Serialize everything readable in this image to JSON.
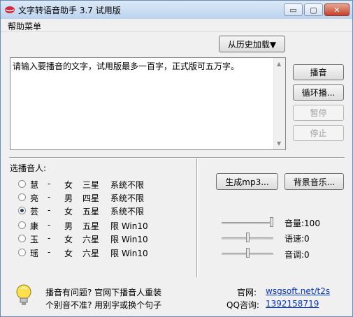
{
  "window": {
    "title": "文字转语音助手 3.7 试用版",
    "min_glyph": "▭",
    "max_glyph": "▢",
    "close_glyph": "✕"
  },
  "menu": {
    "help": "帮助菜单"
  },
  "history_button": "从历史加载▼",
  "text_input": {
    "value": "请输入要播音的文字，试用版最多一百字，正式版可五万字。"
  },
  "scroll": {
    "up": "▲",
    "down": "▼"
  },
  "side_buttons": {
    "play": "播音",
    "loop": "循环播...",
    "pause": "暂停",
    "stop": "停止"
  },
  "voice_section": {
    "label": "选播音人:",
    "voices": [
      {
        "name": "慧",
        "gender": "女",
        "stars": "三星",
        "limit": "系统不限",
        "checked": false
      },
      {
        "name": "亮",
        "gender": "男",
        "stars": "四星",
        "limit": "系统不限",
        "checked": false
      },
      {
        "name": "芸",
        "gender": "女",
        "stars": "五星",
        "limit": "系统不限",
        "checked": true
      },
      {
        "name": "康",
        "gender": "男",
        "stars": "五星",
        "limit": "限 Win10",
        "checked": false
      },
      {
        "name": "玉",
        "gender": "女",
        "stars": "六星",
        "limit": "限 Win10",
        "checked": false
      },
      {
        "name": "瑶",
        "gender": "女",
        "stars": "六星",
        "limit": "限 Win10",
        "checked": false
      }
    ]
  },
  "actions": {
    "mp3": "生成mp3...",
    "bgm": "背景音乐..."
  },
  "sliders": {
    "volume": {
      "label": "音量:100",
      "fraction": 1.0
    },
    "speed": {
      "label": "语速:0",
      "fraction": 0.5
    },
    "pitch": {
      "label": "音调:0",
      "fraction": 0.5
    }
  },
  "footer": {
    "tip_line1": "播音有问题? 官网下播音人重装",
    "tip_line2": "个别音不准? 用别字或换个句子",
    "site_label": "官网:",
    "site_link": "wsgsoft.net/t2s",
    "qq_label": "QQ咨询:",
    "qq_value": "1392158719"
  },
  "colors": {
    "title_gradient_top": "#dce9f7",
    "close_red": "#c4412a",
    "link": "#0033cc"
  }
}
